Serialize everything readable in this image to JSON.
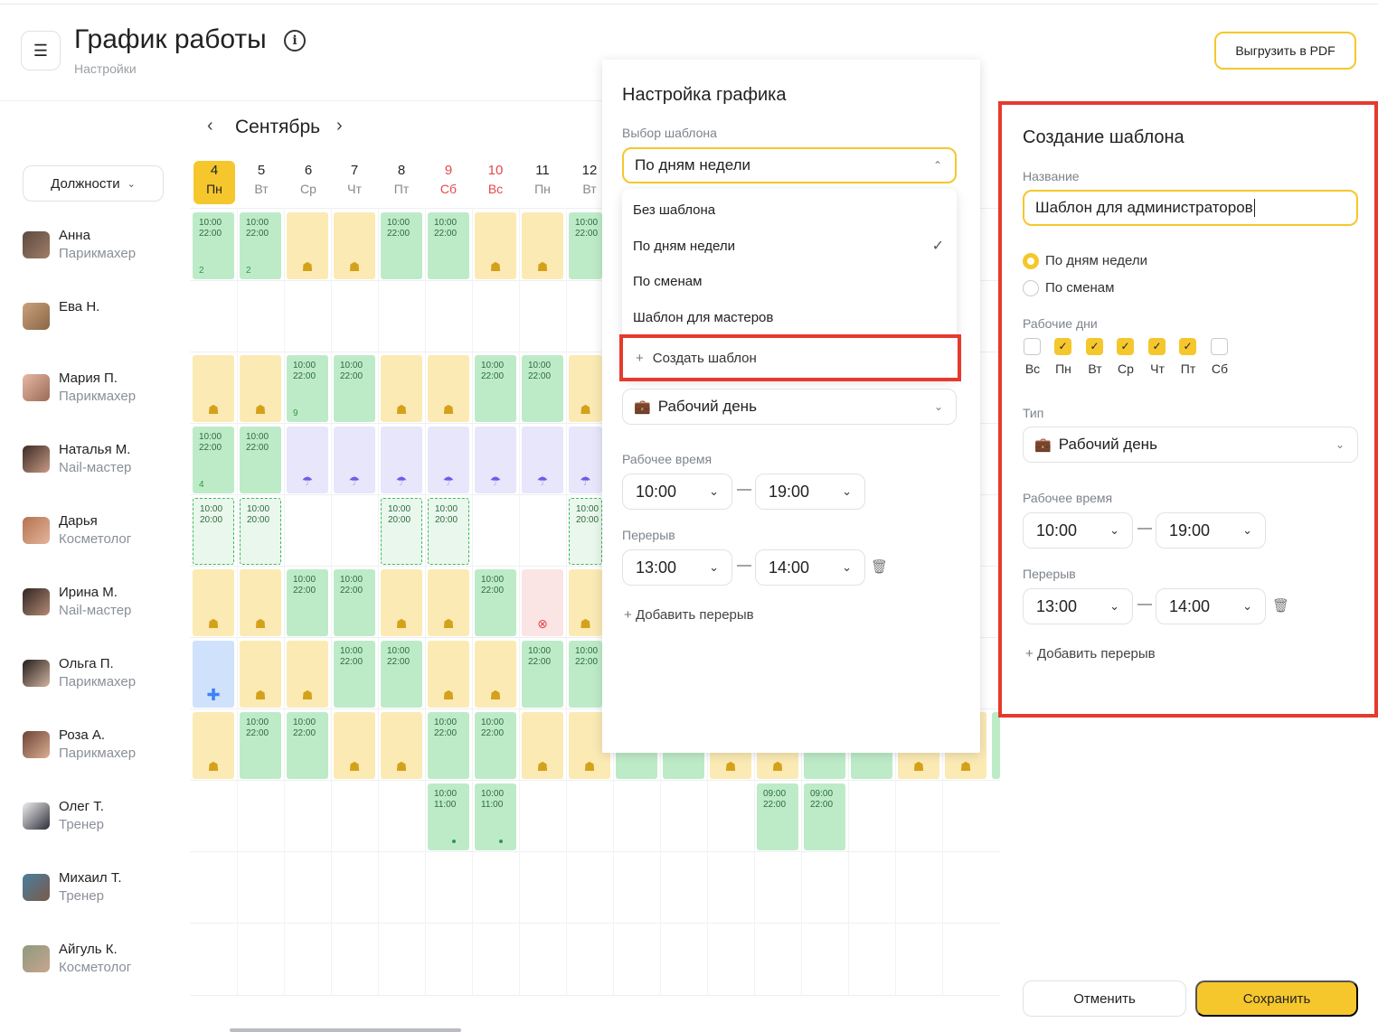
{
  "header": {
    "menu_icon": "hamburger-icon",
    "title": "График работы",
    "info_icon": "info-icon",
    "breadcrumb": "Настройки",
    "export_pdf_label": "Выгрузить в PDF"
  },
  "calendar": {
    "month": "Сентябрь",
    "positions_filter": "Должности",
    "days": [
      {
        "num": "4",
        "wd": "Пн"
      },
      {
        "num": "5",
        "wd": "Вт"
      },
      {
        "num": "6",
        "wd": "Ср"
      },
      {
        "num": "7",
        "wd": "Чт"
      },
      {
        "num": "8",
        "wd": "Пт"
      },
      {
        "num": "9",
        "wd": "Сб"
      },
      {
        "num": "10",
        "wd": "Вс"
      },
      {
        "num": "11",
        "wd": "Пн"
      },
      {
        "num": "12",
        "wd": "Вт"
      }
    ],
    "employees": [
      {
        "name": "Анна",
        "role": "Парикмахер"
      },
      {
        "name": "Ева Н.",
        "role": ""
      },
      {
        "name": "Мария П.",
        "role": "Парикмахер"
      },
      {
        "name": "Наталья М.",
        "role": "Nail-мастер"
      },
      {
        "name": "Дарья",
        "role": "Косметолог"
      },
      {
        "name": "Ирина М.",
        "role": "Nail-мастер"
      },
      {
        "name": "Ольга П.",
        "role": "Парикмахер"
      },
      {
        "name": "Роза А.",
        "role": "Парикмахер"
      },
      {
        "name": "Олег Т.",
        "role": "Тренер"
      },
      {
        "name": "Михаил Т.",
        "role": "Тренер"
      },
      {
        "name": "Айгуль К.",
        "role": "Косметолог"
      }
    ],
    "shift_10_22": "10:00\n22:00",
    "shift_10_20": "10:00\n20:00",
    "shift_10_11": "10:00\n11:00",
    "shift_09_22": "09:00\n22:00",
    "count_2": "2",
    "count_9": "9",
    "count_4": "4"
  },
  "settings": {
    "title": "Настройка графика",
    "template_label": "Выбор шаблона",
    "template_value": "По дням недели",
    "dropdown": {
      "options": [
        "Без шаблона",
        "По дням недели",
        "По сменам",
        "Шаблон для мастеров"
      ],
      "selected_index": 1,
      "create_label": "Создать шаблон"
    },
    "type_value": "Рабочий день",
    "work_time_label": "Рабочее время",
    "work_from": "10:00",
    "work_to": "19:00",
    "break_label": "Перерыв",
    "break_from": "13:00",
    "break_to": "14:00",
    "add_break_label": "Добавить перерыв"
  },
  "template": {
    "title": "Создание шаблона",
    "name_label": "Название",
    "name_value": "Шаблон для администраторов",
    "radio_weekdays": "По дням недели",
    "radio_shifts": "По сменам",
    "workdays_label": "Рабочие дни",
    "workdays": [
      {
        "label": "Вс",
        "checked": false
      },
      {
        "label": "Пн",
        "checked": true
      },
      {
        "label": "Вт",
        "checked": true
      },
      {
        "label": "Ср",
        "checked": true
      },
      {
        "label": "Чт",
        "checked": true
      },
      {
        "label": "Пт",
        "checked": true
      },
      {
        "label": "Сб",
        "checked": false
      }
    ],
    "type_label": "Тип",
    "type_value": "Рабочий день",
    "work_time_label": "Рабочее время",
    "work_from": "10:00",
    "work_to": "19:00",
    "break_label": "Перерыв",
    "break_from": "13:00",
    "break_to": "14:00",
    "add_break_label": "Добавить перерыв",
    "cancel_label": "Отменить",
    "save_label": "Сохранить"
  },
  "colors": {
    "accent": "#f5c72c",
    "highlight_frame": "#e53a2d",
    "shift_green": "#bdebc8",
    "day_off_yellow": "#fbeab4",
    "vacation_purple": "#e8e6fb"
  }
}
